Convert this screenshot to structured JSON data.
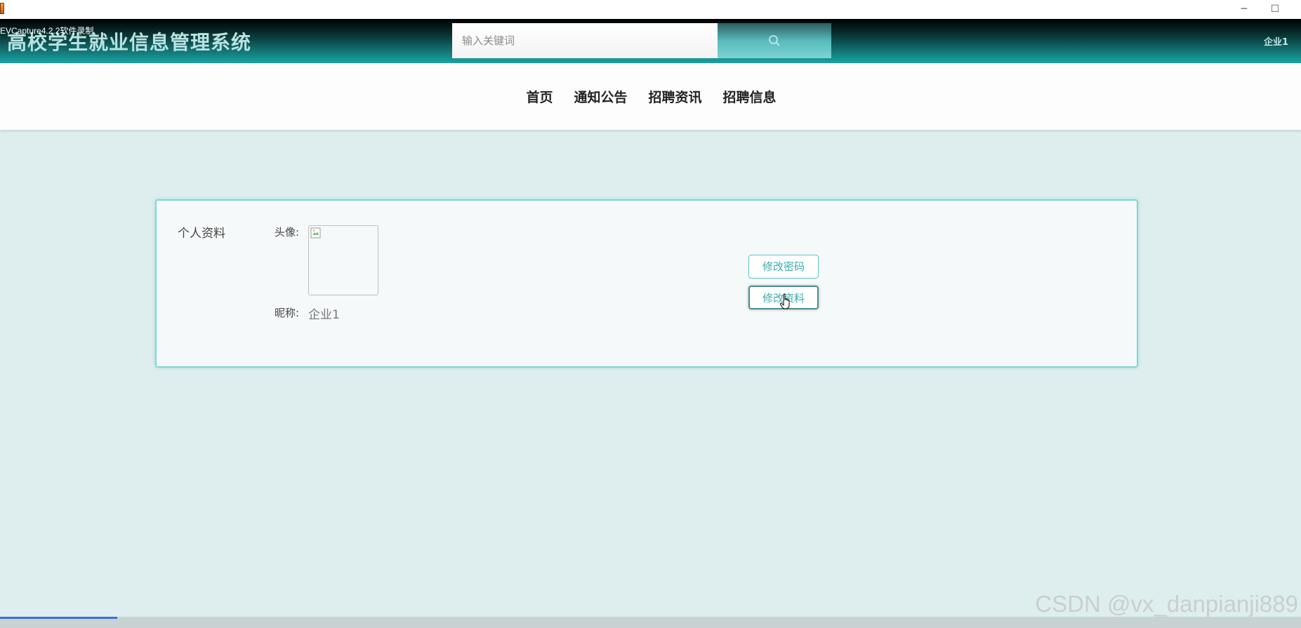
{
  "window": {
    "recorder_label": "EVCapture4.2.2软件录制",
    "minimize_symbol": "─",
    "maximize_symbol": "☐"
  },
  "header": {
    "site_title": "高校学生就业信息管理系统",
    "search": {
      "placeholder": "输入关键词"
    },
    "user_name": "企业1"
  },
  "nav": {
    "items": [
      {
        "label": "首页"
      },
      {
        "label": "通知公告"
      },
      {
        "label": "招聘资讯"
      },
      {
        "label": "招聘信息"
      }
    ]
  },
  "profile": {
    "card_title": "个人资料",
    "avatar_label": "头像:",
    "nickname_label": "昵称:",
    "nickname_value": "企业1",
    "change_password_label": "修改密码",
    "edit_profile_label": "修改资料"
  },
  "watermark": "CSDN @vx_danpianji889",
  "progress": {
    "fraction": 0.09
  },
  "colors": {
    "accent": "#3aabab",
    "header_teal": "#1aa5a5",
    "page_background": "#deeeee"
  }
}
